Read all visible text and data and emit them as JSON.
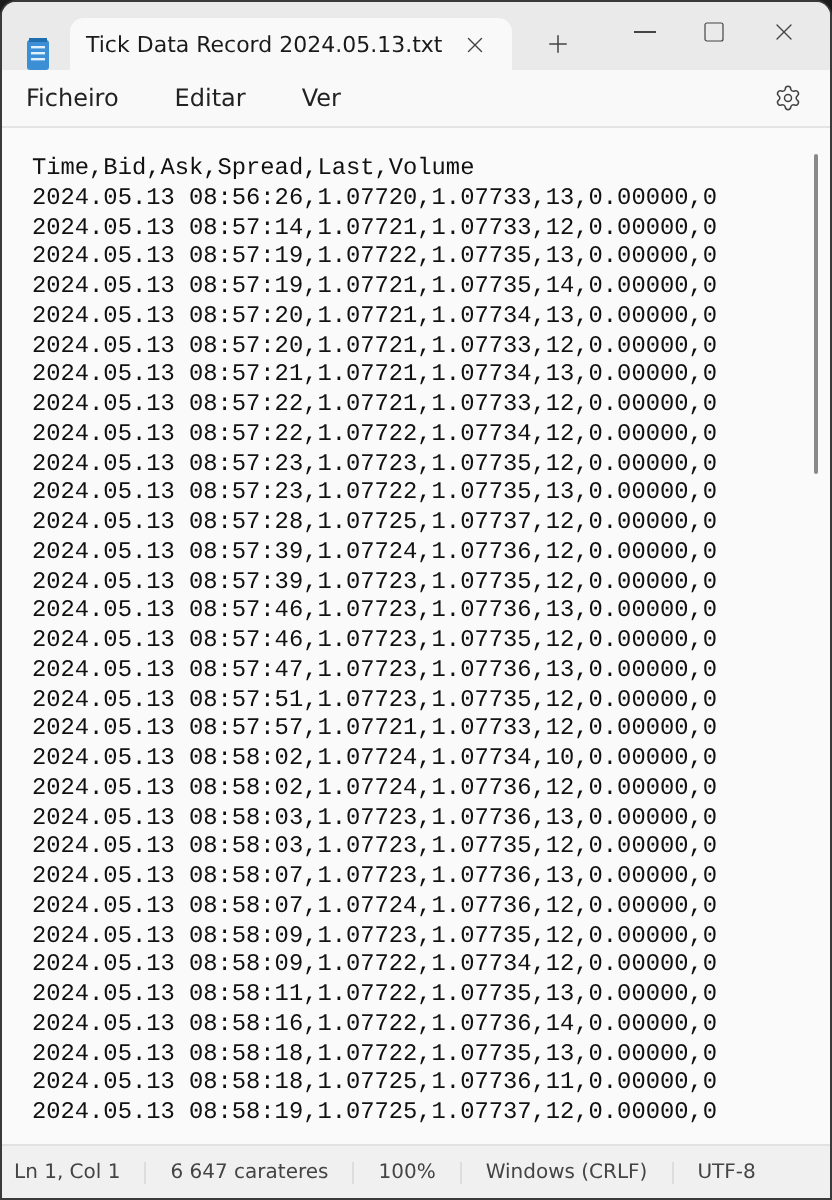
{
  "tab": {
    "title": "Tick Data Record 2024.05.13.txt",
    "selected": true
  },
  "menu": [
    "Ficheiro",
    "Editar",
    "Ver"
  ],
  "lines": [
    "Time,Bid,Ask,Spread,Last,Volume",
    "2024.05.13 08:56:26,1.07720,1.07733,13,0.00000,0",
    "2024.05.13 08:57:14,1.07721,1.07733,12,0.00000,0",
    "2024.05.13 08:57:19,1.07722,1.07735,13,0.00000,0",
    "2024.05.13 08:57:19,1.07721,1.07735,14,0.00000,0",
    "2024.05.13 08:57:20,1.07721,1.07734,13,0.00000,0",
    "2024.05.13 08:57:20,1.07721,1.07733,12,0.00000,0",
    "2024.05.13 08:57:21,1.07721,1.07734,13,0.00000,0",
    "2024.05.13 08:57:22,1.07721,1.07733,12,0.00000,0",
    "2024.05.13 08:57:22,1.07722,1.07734,12,0.00000,0",
    "2024.05.13 08:57:23,1.07723,1.07735,12,0.00000,0",
    "2024.05.13 08:57:23,1.07722,1.07735,13,0.00000,0",
    "2024.05.13 08:57:28,1.07725,1.07737,12,0.00000,0",
    "2024.05.13 08:57:39,1.07724,1.07736,12,0.00000,0",
    "2024.05.13 08:57:39,1.07723,1.07735,12,0.00000,0",
    "2024.05.13 08:57:46,1.07723,1.07736,13,0.00000,0",
    "2024.05.13 08:57:46,1.07723,1.07735,12,0.00000,0",
    "2024.05.13 08:57:47,1.07723,1.07736,13,0.00000,0",
    "2024.05.13 08:57:51,1.07723,1.07735,12,0.00000,0",
    "2024.05.13 08:57:57,1.07721,1.07733,12,0.00000,0",
    "2024.05.13 08:58:02,1.07724,1.07734,10,0.00000,0",
    "2024.05.13 08:58:02,1.07724,1.07736,12,0.00000,0",
    "2024.05.13 08:58:03,1.07723,1.07736,13,0.00000,0",
    "2024.05.13 08:58:03,1.07723,1.07735,12,0.00000,0",
    "2024.05.13 08:58:07,1.07723,1.07736,13,0.00000,0",
    "2024.05.13 08:58:07,1.07724,1.07736,12,0.00000,0",
    "2024.05.13 08:58:09,1.07723,1.07735,12,0.00000,0",
    "2024.05.13 08:58:09,1.07722,1.07734,12,0.00000,0",
    "2024.05.13 08:58:11,1.07722,1.07735,13,0.00000,0",
    "2024.05.13 08:58:16,1.07722,1.07736,14,0.00000,0",
    "2024.05.13 08:58:18,1.07722,1.07735,13,0.00000,0",
    "2024.05.13 08:58:18,1.07725,1.07736,11,0.00000,0",
    "2024.05.13 08:58:19,1.07725,1.07737,12,0.00000,0"
  ],
  "status_bar": [
    "Ln 1, Col 1",
    "6 647 carateres",
    "100%",
    "Windows (CRLF)",
    "UTF-8"
  ]
}
